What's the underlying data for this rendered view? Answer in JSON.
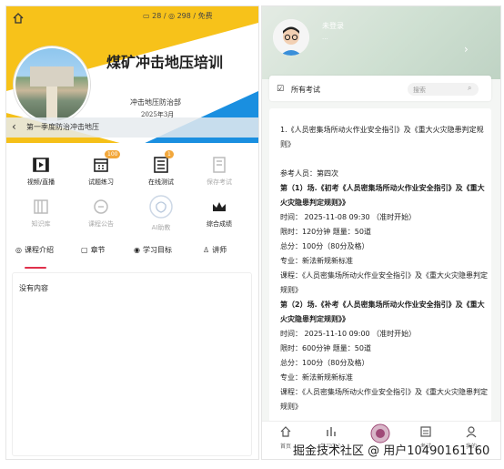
{
  "left": {
    "status_counts": "28 / ◎ 298 / 免费",
    "course_title": "煤矿冲击地压培训",
    "department": "冲击地压防治部",
    "date": "2025年3月",
    "back_label": "第一季度防治冲击地压",
    "menu": [
      {
        "label": "视频/直播",
        "badge": ""
      },
      {
        "label": "试题练习",
        "badge": "100"
      },
      {
        "label": "在线测试",
        "badge": "1"
      },
      {
        "label": "保存考试",
        "badge": ""
      },
      {
        "label": "知识库",
        "badge": ""
      },
      {
        "label": "课程公告",
        "badge": ""
      },
      {
        "label": "AI助教",
        "badge": ""
      },
      {
        "label": "综合成绩",
        "badge": ""
      }
    ],
    "tabs": [
      "课程介绍",
      "章节",
      "学习目标",
      "讲师"
    ],
    "empty_text": "没有内容"
  },
  "right": {
    "login_label": "未登录",
    "login_sub": "...",
    "exam_section_title": "所有考试",
    "search_placeholder": "搜索",
    "exam_lines": [
      {
        "text": "1.《人员密集场所动火作业安全指引》及《重大火灾隐患判定规则》",
        "bold": false
      },
      {
        "text": "",
        "bold": false
      },
      {
        "text": "参考人员：第四次",
        "bold": false
      },
      {
        "text": "第（1）场.《初考《人员密集场所动火作业安全指引》及《重大火灾隐患判定规则》》",
        "bold": true
      },
      {
        "text": "时间：  2025-11-08 09:30  （准时开始）",
        "bold": false
      },
      {
        "text": "限时：120分钟   题量：50道",
        "bold": false
      },
      {
        "text": "总分：100分（80分及格）",
        "bold": false
      },
      {
        "text": "专业：新法新规新标准",
        "bold": false
      },
      {
        "text": "课程：《人员密集场所动火作业安全指引》及《重大火灾隐患判定规则》",
        "bold": false
      },
      {
        "text": "第（2）场.《补考《人员密集场所动火作业安全指引》及《重大火灾隐患判定规则》》",
        "bold": true
      },
      {
        "text": "时间：  2025-11-10 09:00  （准时开始）",
        "bold": false
      },
      {
        "text": "限时：600分钟   题量：50道",
        "bold": false
      },
      {
        "text": "总分：100分（80分及格）",
        "bold": false
      },
      {
        "text": "专业：新法新规新标准",
        "bold": false
      },
      {
        "text": "课程：《人员密集场所动火作业安全指引》及《重大火灾隐患判定规则》",
        "bold": false
      }
    ],
    "nav": [
      "首页",
      "学习中心",
      "",
      "考试",
      "我的"
    ]
  },
  "watermark": "掘金技术社区 @ 用户10490161160",
  "colors": {
    "accent": "#e0314b",
    "banner_yellow": "#f7c21a",
    "banner_blue": "#1a8fe0",
    "badge": "#f2a73b"
  }
}
